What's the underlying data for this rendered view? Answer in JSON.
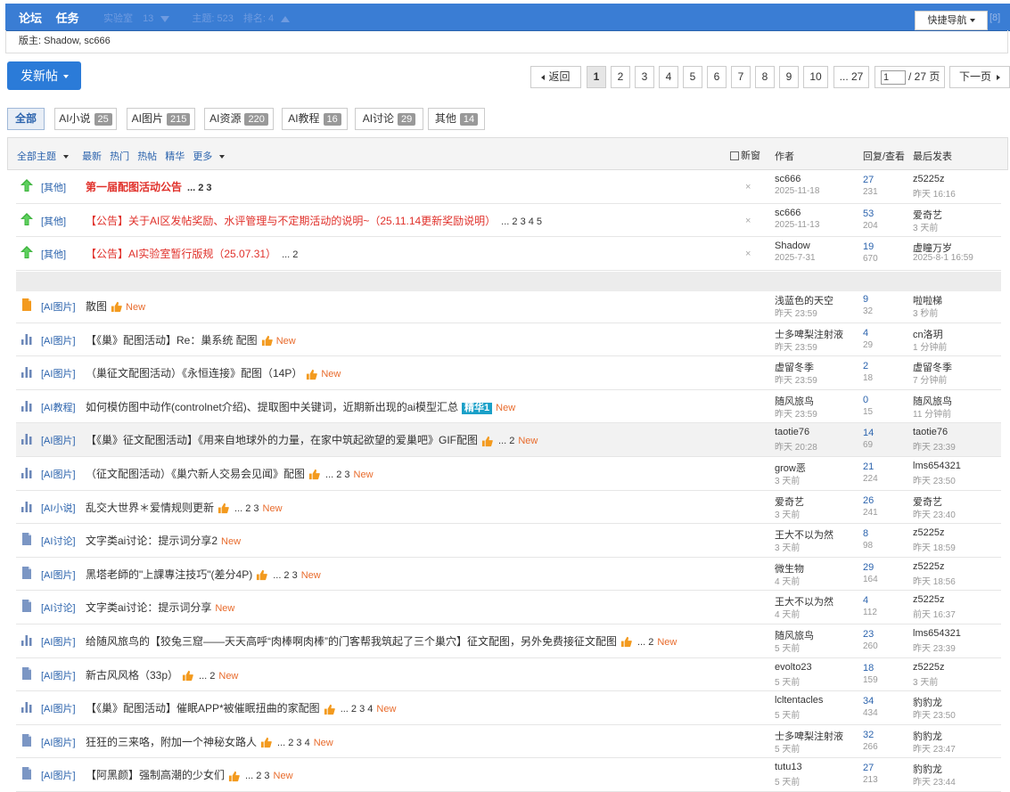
{
  "topbar": {
    "nav": [
      "论坛",
      "任务"
    ],
    "faded_text": [
      "实验室",
      "13",
      "主题: 523",
      "排名: 4"
    ],
    "quick_nav": "快捷导航",
    "quick_nav_extra": "[8]"
  },
  "moderators": "版主: Shadow, sc666",
  "post_button": "发新帖",
  "pager": {
    "back": "返回",
    "pages": [
      "1",
      "2",
      "3",
      "4",
      "5",
      "6",
      "7",
      "8",
      "9",
      "10",
      "... 27"
    ],
    "current": "1",
    "input_value": "1",
    "total": "/ 27 页",
    "next": "下一页"
  },
  "categories": [
    {
      "label": "全部",
      "count": ""
    },
    {
      "label": "AI小说",
      "count": "25"
    },
    {
      "label": "AI图片",
      "count": "215"
    },
    {
      "label": "AI资源",
      "count": "220"
    },
    {
      "label": "AI教程",
      "count": "16"
    },
    {
      "label": "AI讨论",
      "count": "29"
    },
    {
      "label": "其他",
      "count": "14"
    }
  ],
  "list_header": {
    "filters": [
      "全部主题",
      "最新",
      "热门",
      "热帖",
      "精华",
      "更多"
    ],
    "new_window": "新窗",
    "author": "作者",
    "reply_view": "回复/查看",
    "last_post": "最后发表"
  },
  "pinned": [
    {
      "tag": "[其他]",
      "title": "第一届配图活动公告",
      "pages": "... 2 3",
      "author": "sc666",
      "date": "2025-11-18",
      "replies": "27",
      "views": "231",
      "last_user": "z5225z",
      "last_time": "昨天 16:16"
    },
    {
      "tag": "[其他]",
      "title": "【公告】关于AI区发帖奖励、水评管理与不定期活动的说明~（25.11.14更新奖励说明）",
      "pages": "... 2 3 4 5",
      "author": "sc666",
      "date": "2025-11-13",
      "replies": "53",
      "views": "204",
      "last_user": "爱奇艺",
      "last_time": "3 天前"
    },
    {
      "tag": "[其他]",
      "title": "【公告】AI实验室暂行版规（25.07.31）",
      "pages": "... 2",
      "author": "Shadow",
      "date": "2025-7-31",
      "replies": "19",
      "views": "670",
      "last_user": "虚瞳万岁",
      "last_time": "2025-8-1 16:59"
    }
  ],
  "threads": [
    {
      "icon": "hot",
      "tag": "[AI图片]",
      "title": "散图",
      "pages": "",
      "like": true,
      "essence": "",
      "new": "New",
      "author": "浅蓝色的天空",
      "date": "昨天 23:59",
      "replies": "9",
      "views": "32",
      "last_user": "啦啦梯",
      "last_time": "3 秒前"
    },
    {
      "icon": "poll",
      "tag": "[AI图片]",
      "title": "【《巢》配图活动】Re：巢系统 配图",
      "pages": "",
      "like": true,
      "essence": "",
      "new": "New",
      "author": "士多啤梨注射液",
      "date": "昨天 23:59",
      "replies": "4",
      "views": "29",
      "last_user": "cn洛玥",
      "last_time": "1 分钟前"
    },
    {
      "icon": "poll",
      "tag": "[AI图片]",
      "title": "（巢征文配图活动）《永恒连接》配图（14P）",
      "pages": "",
      "like": true,
      "essence": "",
      "new": "New",
      "author": "虚留冬季",
      "date": "昨天 23:59",
      "replies": "2",
      "views": "18",
      "last_user": "虚留冬季",
      "last_time": "7 分钟前"
    },
    {
      "icon": "poll",
      "tag": "[AI教程]",
      "title": "如何模仿图中动作(controlnet介绍)、提取图中关键词，近期新出现的ai模型汇总",
      "pages": "",
      "like": false,
      "essence": "精华1",
      "new": "New",
      "author": "随风旅鸟",
      "date": "昨天 23:59",
      "replies": "0",
      "views": "15",
      "last_user": "随风旅鸟",
      "last_time": "11 分钟前"
    },
    {
      "icon": "poll",
      "tag": "[AI图片]",
      "title": "【《巢》征文配图活动】《用来自地球外的力量，在家中筑起欲望的爱巢吧》GIF配图",
      "pages": "... 2",
      "like": true,
      "essence": "",
      "new": "New",
      "author": "taotie76",
      "date": "昨天 20:28",
      "replies": "14",
      "views": "69",
      "last_user": "taotie76",
      "last_time": "昨天 23:39"
    },
    {
      "icon": "poll",
      "tag": "[AI图片]",
      "title": "（征文配图活动）《巢穴新人交易会见闻》配图",
      "pages": "... 2 3",
      "like": true,
      "essence": "",
      "new": "New",
      "author": "grow恶",
      "date": "3 天前",
      "replies": "21",
      "views": "224",
      "last_user": "lms654321",
      "last_time": "昨天 23:50"
    },
    {
      "icon": "poll",
      "tag": "[AI小说]",
      "title": "乱交大世界＊爱情规则更新",
      "pages": "... 2 3",
      "like": true,
      "essence": "",
      "new": "New",
      "author": "爱奇艺",
      "date": "3 天前",
      "replies": "26",
      "views": "241",
      "last_user": "爱奇艺",
      "last_time": "昨天 23:40"
    },
    {
      "icon": "doc",
      "tag": "[AI讨论]",
      "title": "文字类ai讨论：提示词分享2",
      "pages": "",
      "like": false,
      "essence": "",
      "new": "New",
      "author": "王大不以为然",
      "date": "3 天前",
      "replies": "8",
      "views": "98",
      "last_user": "z5225z",
      "last_time": "昨天 18:59"
    },
    {
      "icon": "doc",
      "tag": "[AI图片]",
      "title": "黑塔老師的\"上課專注技巧\"(差分4P)",
      "pages": "... 2 3",
      "like": true,
      "essence": "",
      "new": "New",
      "author": "微生物",
      "date": "4 天前",
      "replies": "29",
      "views": "164",
      "last_user": "z5225z",
      "last_time": "昨天 18:56"
    },
    {
      "icon": "doc",
      "tag": "[AI讨论]",
      "title": "文字类ai讨论：提示词分享",
      "pages": "",
      "like": false,
      "essence": "",
      "new": "New",
      "author": "王大不以为然",
      "date": "4 天前",
      "replies": "4",
      "views": "112",
      "last_user": "z5225z",
      "last_time": "前天 16:37"
    },
    {
      "icon": "poll",
      "tag": "[AI图片]",
      "title": "给随风旅鸟的【狡兔三窟——天天高呼“肉棒啊肉棒”的门客帮我筑起了三个巢穴】征文配图，另外免费接征文配图",
      "pages": "... 2",
      "like": true,
      "essence": "",
      "new": "New",
      "author": "随风旅鸟",
      "date": "5 天前",
      "replies": "23",
      "views": "260",
      "last_user": "lms654321",
      "last_time": "昨天 23:39"
    },
    {
      "icon": "doc",
      "tag": "[AI图片]",
      "title": "新古风风格（33p）",
      "pages": "... 2",
      "like": true,
      "essence": "",
      "new": "New",
      "author": "evolto23",
      "date": "5 天前",
      "replies": "18",
      "views": "159",
      "last_user": "z5225z",
      "last_time": "3 天前"
    },
    {
      "icon": "poll",
      "tag": "[AI图片]",
      "title": "【《巢》配图活动】催眠APP*被催眠扭曲的家配图",
      "pages": "... 2 3 4",
      "like": true,
      "essence": "",
      "new": "New",
      "author": "lcltentacles",
      "date": "5 天前",
      "replies": "34",
      "views": "434",
      "last_user": "豹豹龙",
      "last_time": "昨天 23:50"
    },
    {
      "icon": "doc",
      "tag": "[AI图片]",
      "title": "狂狂的三来咯，附加一个神秘女路人",
      "pages": "... 2 3 4",
      "like": true,
      "essence": "",
      "new": "New",
      "author": "士多啤梨注射液",
      "date": "5 天前",
      "replies": "32",
      "views": "266",
      "last_user": "豹豹龙",
      "last_time": "昨天 23:47"
    },
    {
      "icon": "doc",
      "tag": "[AI图片]",
      "title": "【阿黑颜】强制高潮的少女们",
      "pages": "... 2 3",
      "like": true,
      "essence": "",
      "new": "New",
      "author": "tutu13",
      "date": "5 天前",
      "replies": "27",
      "views": "213",
      "last_user": "豹豹龙",
      "last_time": "昨天 23:44"
    }
  ],
  "colors": {
    "accent": "#2b7bd8",
    "pinned_red": "#e0312b",
    "new": "#e86b2c",
    "essence": "#1aa0c8",
    "link": "#2b63ad"
  }
}
